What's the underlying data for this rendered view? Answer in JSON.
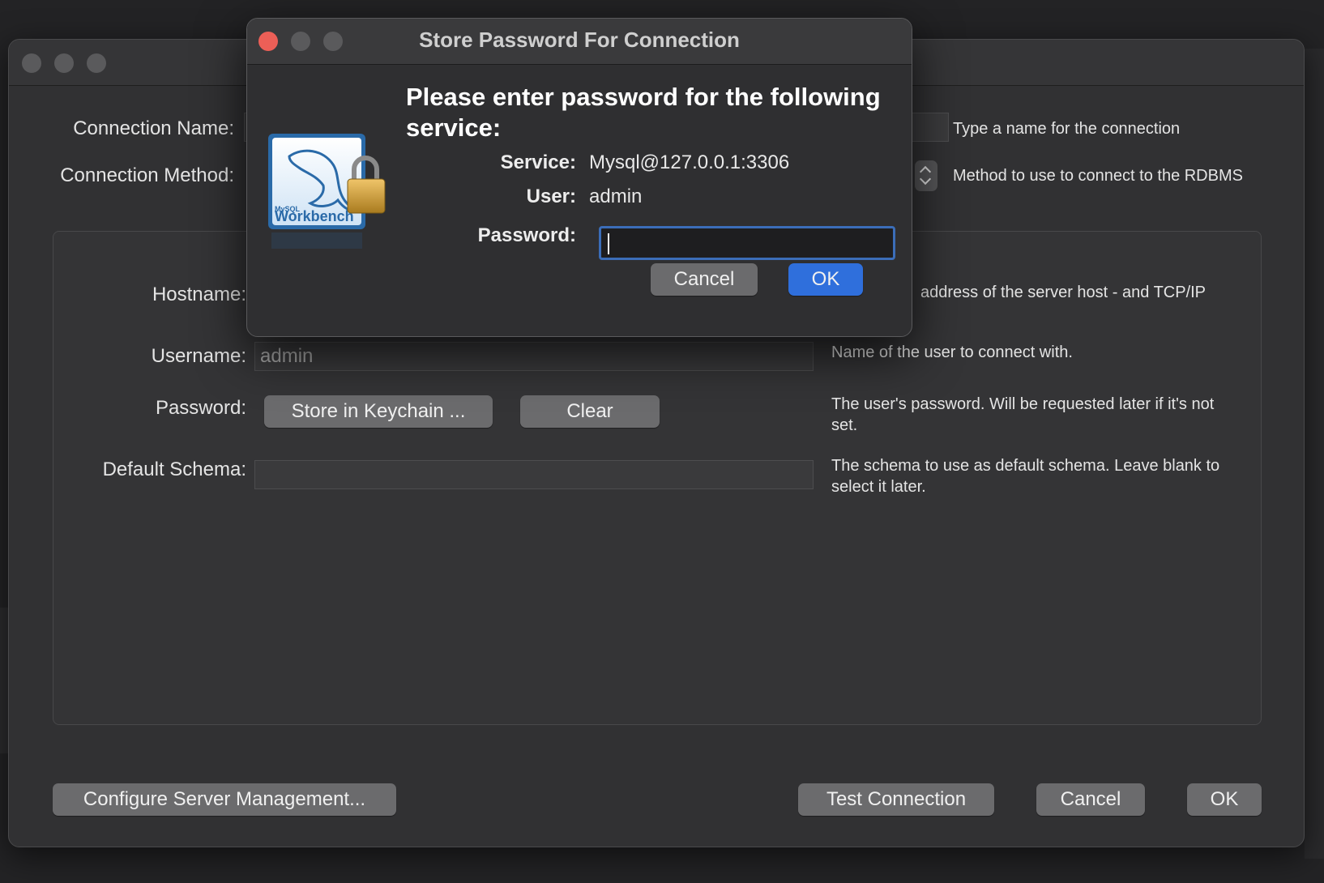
{
  "main_window": {
    "connection_name_label": "Connection Name:",
    "connection_name_hint": "Type a name for the connection",
    "connection_method_label": "Connection Method:",
    "connection_method_hint": "Method to use to connect to the RDBMS",
    "hostname_label": "Hostname:",
    "hostname_hint": "address of the server host - and TCP/IP",
    "username_label": "Username:",
    "username_value": "admin",
    "username_hint": "Name of the user to connect with.",
    "password_label": "Password:",
    "store_keychain_button": "Store in Keychain ...",
    "clear_button": "Clear",
    "password_hint": "The user's password. Will be requested later if it's not set.",
    "default_schema_label": "Default Schema:",
    "default_schema_value": "",
    "default_schema_hint": "The schema to use as default schema. Leave blank to select it later.",
    "configure_button": "Configure Server Management...",
    "test_connection_button": "Test Connection",
    "cancel_button": "Cancel",
    "ok_button": "OK"
  },
  "dialog": {
    "title": "Store Password For Connection",
    "heading": "Please enter password for the following service:",
    "service_label": "Service:",
    "service_value": "Mysql@127.0.0.1:3306",
    "user_label": "User:",
    "user_value": "admin",
    "password_label": "Password:",
    "password_value": "",
    "cancel_button": "Cancel",
    "ok_button": "OK",
    "logo_text_small": "MySQL",
    "logo_text": "Workbench"
  },
  "colors": {
    "accent": "#2f6fdc",
    "close_red": "#ec5f57",
    "window_bg": "#313133",
    "dialog_bg": "#2f2f31"
  },
  "icons": {
    "logo": "mysql-workbench-dolphin-icon",
    "lock": "padlock-icon",
    "stepper": "up-down-stepper-icon"
  }
}
